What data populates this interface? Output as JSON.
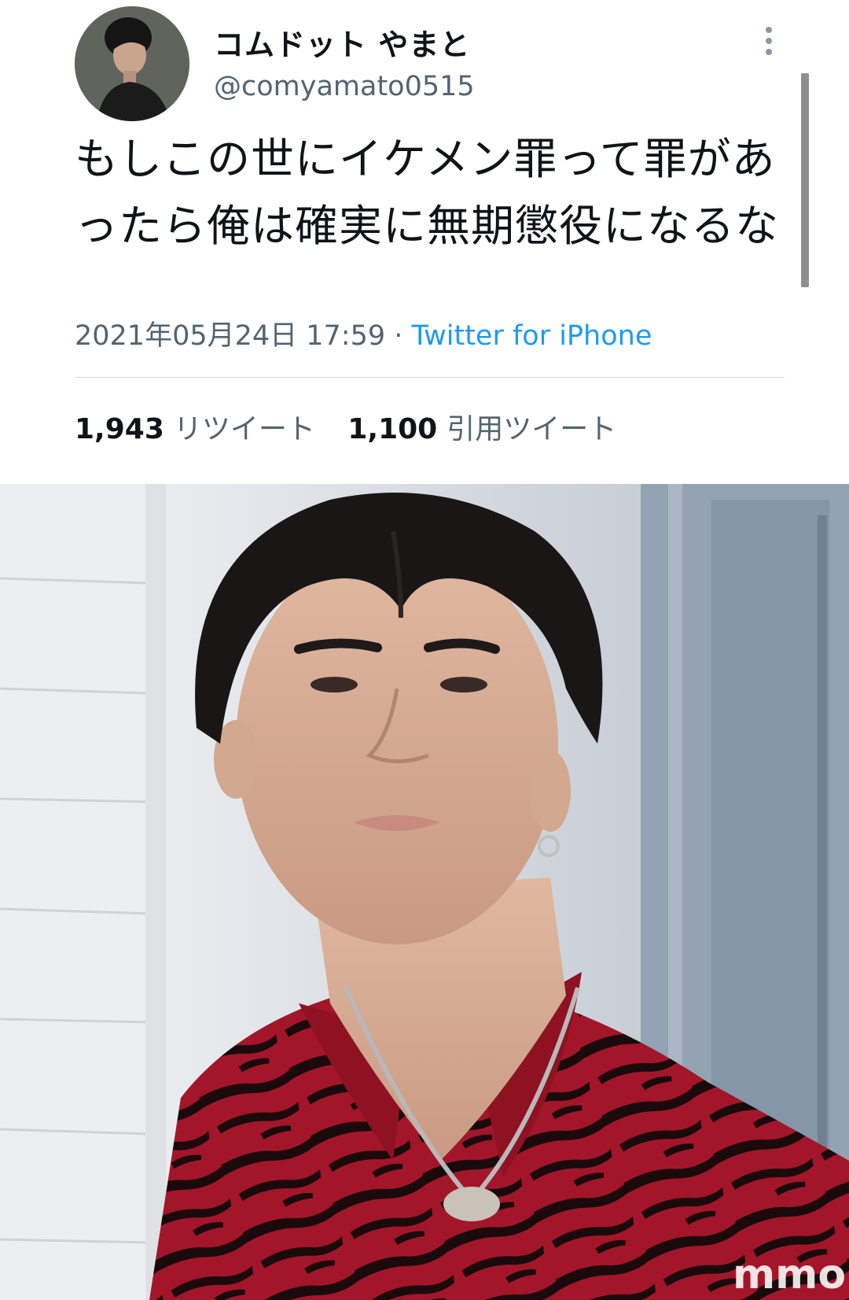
{
  "tweet": {
    "display_name": "コムドット やまと",
    "handle": "@comyamato0515",
    "text": "もしこの世にイケメン罪って罪があったら俺は確実に無期懲役になるな",
    "timestamp": "2021年05月24日 17:59",
    "separator": " · ",
    "source": "Twitter for iPhone",
    "retweet_count": "1,943",
    "retweet_label": "リツイート",
    "quote_count": "1,100",
    "quote_label": "引用ツイート",
    "more_icon": "more-vertical-icon"
  },
  "photo": {
    "watermark": "mmo"
  },
  "colors": {
    "text_primary": "#0f1419",
    "text_secondary": "#536471",
    "link": "#1d9bf0",
    "shirt_red": "#a3162a",
    "shirt_stripe": "#1a0a0c"
  }
}
